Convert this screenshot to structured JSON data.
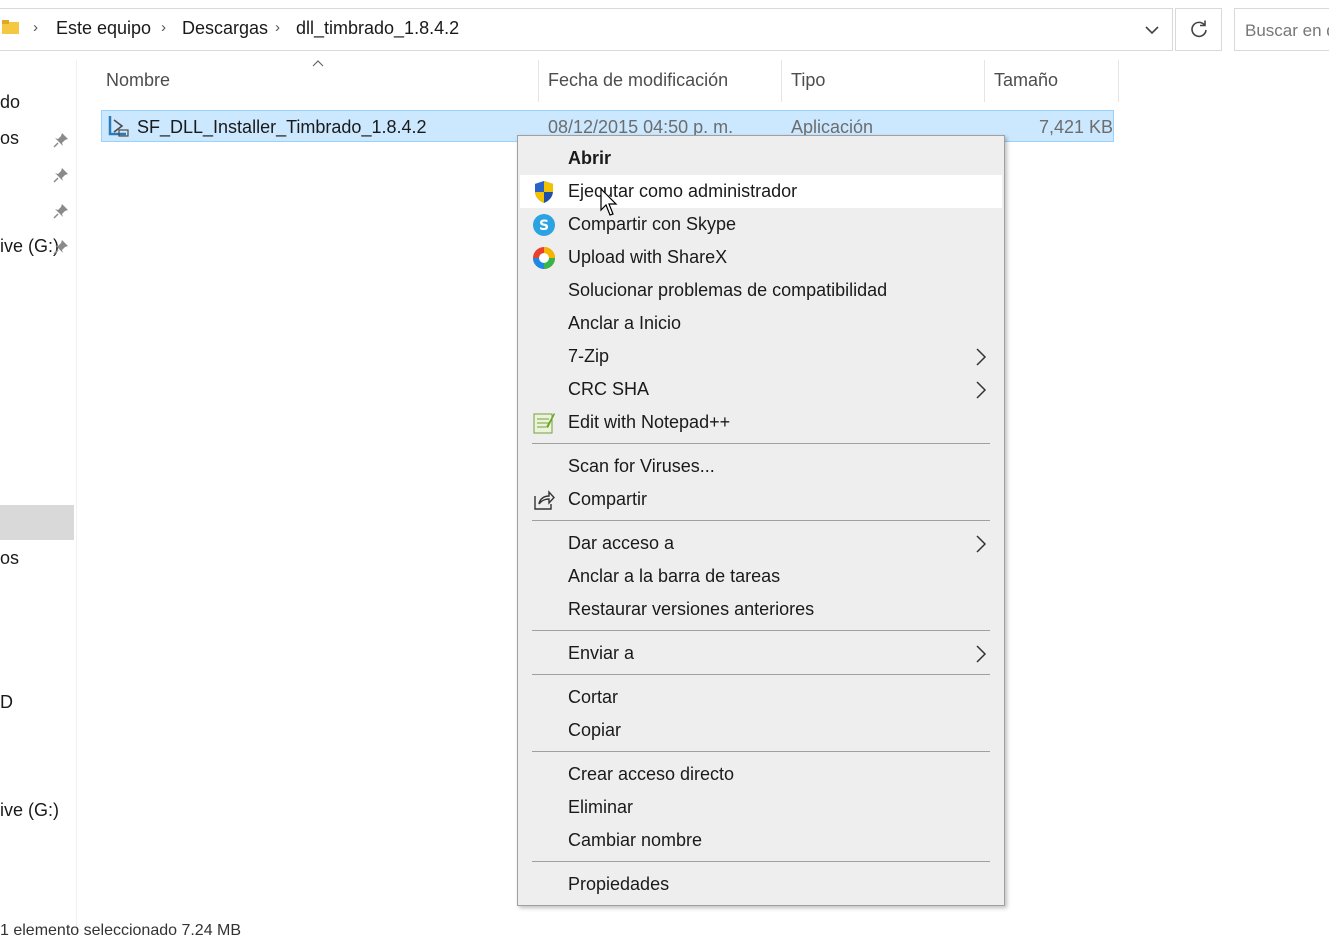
{
  "address": {
    "crumbs": [
      "Este equipo",
      "Descargas",
      "dll_timbrado_1.8.4.2"
    ],
    "search_placeholder": "Buscar en d"
  },
  "nav": {
    "items": [
      "do",
      "os",
      "ive (G:)",
      "os",
      "D",
      "ive (G:)"
    ]
  },
  "columns": {
    "name": "Nombre",
    "modified": "Fecha de modificación",
    "type": "Tipo",
    "size": "Tamaño"
  },
  "file": {
    "name": "SF_DLL_Installer_Timbrado_1.8.4.2",
    "modified": "08/12/2015 04:50 p. m.",
    "type": "Aplicación",
    "size": "7,421 KB"
  },
  "context_menu": {
    "items": [
      {
        "label": "Abrir",
        "bold": true
      },
      {
        "label": "Ejecutar como administrador",
        "icon": "uac-shield-icon",
        "hovered": true
      },
      {
        "label": "Compartir con Skype",
        "icon": "skype-icon"
      },
      {
        "label": "Upload with ShareX",
        "icon": "sharex-icon"
      },
      {
        "label": "Solucionar problemas de compatibilidad"
      },
      {
        "label": "Anclar a Inicio"
      },
      {
        "label": "7-Zip",
        "submenu": true
      },
      {
        "label": "CRC SHA",
        "submenu": true
      },
      {
        "label": "Edit with Notepad++",
        "icon": "notepadpp-icon"
      },
      {
        "label": "Scan for Viruses..."
      },
      {
        "label": "Compartir",
        "icon": "share-icon"
      },
      {
        "label": "Dar acceso a",
        "submenu": true
      },
      {
        "label": "Anclar a la barra de tareas"
      },
      {
        "label": "Restaurar versiones anteriores"
      },
      {
        "label": "Enviar a",
        "submenu": true
      },
      {
        "label": "Cortar"
      },
      {
        "label": "Copiar"
      },
      {
        "label": "Crear acceso directo"
      },
      {
        "label": "Eliminar"
      },
      {
        "label": "Cambiar nombre"
      },
      {
        "label": "Propiedades"
      }
    ]
  },
  "status": {
    "text": "1 elemento seleccionado 7.24 MB"
  },
  "colors": {
    "selection_bg": "#cce8ff",
    "selection_border": "#99d1ff",
    "menu_bg": "#eeeeee"
  }
}
